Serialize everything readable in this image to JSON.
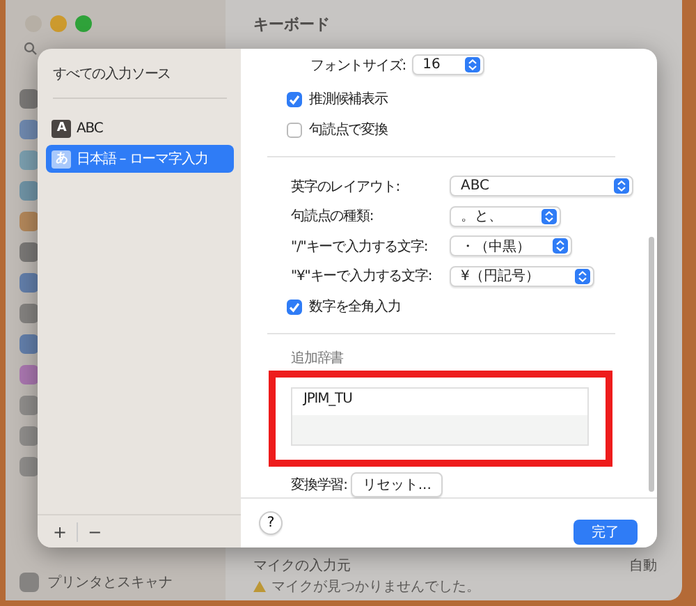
{
  "window": {
    "title": "キーボード"
  },
  "background": {
    "sidebar_item": "プリンタとスキャナ",
    "mic_label": "マイクの入力元",
    "mic_value": "自動",
    "mic_warning": "マイクが見つかりませんでした。"
  },
  "sheet": {
    "sources_title": "すべての入力ソース",
    "sources": [
      {
        "badge": "A",
        "label": "ABC",
        "selected": false
      },
      {
        "badge": "あ",
        "label": "日本語 – ローマ字入力",
        "selected": true
      }
    ],
    "add_button": "+",
    "remove_button": "−",
    "font_size": {
      "label": "フォントサイズ:",
      "value": "16"
    },
    "options_top": [
      {
        "label": "推測候補表示",
        "checked": true
      },
      {
        "label": "句読点で変換",
        "checked": false
      }
    ],
    "popups": [
      {
        "label": "英字のレイアウト:",
        "value": "ABC"
      },
      {
        "label": "句読点の種類:",
        "value": "。と、"
      },
      {
        "label": "\"/\"キーで入力する文字:",
        "value": "・（中黒）"
      },
      {
        "label": "\"¥\"キーで入力する文字:",
        "value": "¥（円記号）"
      }
    ],
    "options_bottom": [
      {
        "label": "数字を全角入力",
        "checked": true
      }
    ],
    "dictionary": {
      "label": "追加辞書",
      "items": [
        "JPIM_TU"
      ]
    },
    "learning": {
      "label": "変換学習:",
      "button": "リセット..."
    },
    "help_button": "?",
    "done_button": "完了"
  }
}
